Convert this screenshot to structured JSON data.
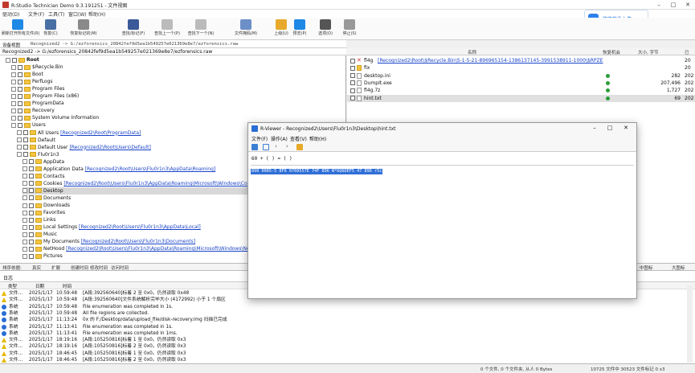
{
  "app": {
    "title": "R-Studio Technician Demo 9.3.191251 - 文件视图",
    "cloud_button": "拖拽至此上传"
  },
  "menu": [
    "驱动(D)",
    "文件(F)",
    "工具(T)",
    "窗口(W)",
    "帮助(H)"
  ],
  "toolbar": [
    {
      "label": "刷新打开所有文件(R)",
      "icon": "refresh-icon",
      "color": "#1e88e5"
    },
    {
      "label": "恢复(C)",
      "icon": "recover-icon",
      "color": "#4a6fa5"
    },
    {
      "label": "恢复标记的(M)",
      "icon": "recover-marked-icon",
      "color": "#8a8a8a"
    },
    {
      "label": "查找/标记(F)",
      "icon": "find-icon",
      "color": "#3b5998"
    },
    {
      "label": "查找上一个(P)",
      "icon": "find-prev-icon",
      "color": "#bbbbbb"
    },
    {
      "label": "查找下一个(N)",
      "icon": "find-next-icon",
      "color": "#bbbbbb"
    },
    {
      "label": "文件掩码(M)",
      "icon": "file-mask-icon",
      "color": "#6d8fc7"
    },
    {
      "label": "上级(U)",
      "icon": "up-folder-icon",
      "color": "#e8a92a"
    },
    {
      "label": "预览(P)",
      "icon": "preview-icon",
      "color": "#1e88e5"
    },
    {
      "label": "选项(O)",
      "icon": "options-icon",
      "color": "#555555"
    },
    {
      "label": "停止(S)",
      "icon": "stop-icon",
      "color": "#999999"
    }
  ],
  "address": {
    "label": "设备视图",
    "path": "Recognized2 -> G:/ezforensics_20842fef9d5ea1b549257e021369e8e7/ezforensics.raw"
  },
  "tree": {
    "root_item": "Recognized2 -> G:/ezforensics_20842fef9d5ea1b549257e021369e8e7/ezforensics.raw",
    "rows": [
      {
        "indent": 1,
        "label": "Root",
        "bold": true
      },
      {
        "indent": 2,
        "label": "$Recycle.Bin"
      },
      {
        "indent": 2,
        "label": "Boot"
      },
      {
        "indent": 2,
        "label": "PerfLogs"
      },
      {
        "indent": 2,
        "label": "Program Files"
      },
      {
        "indent": 2,
        "label": "Program Files (x86)"
      },
      {
        "indent": 2,
        "label": "ProgramData"
      },
      {
        "indent": 2,
        "label": "Recovery"
      },
      {
        "indent": 2,
        "label": "System Volume Information"
      },
      {
        "indent": 2,
        "label": "Users"
      },
      {
        "indent": 3,
        "label": "All Users",
        "link": "[Recognized2\\Root\\ProgramData]"
      },
      {
        "indent": 3,
        "label": "Default"
      },
      {
        "indent": 3,
        "label": "Default User",
        "link": "[Recognized2\\Root\\Users\\Default]"
      },
      {
        "indent": 3,
        "label": "Flu0r1n3"
      },
      {
        "indent": 4,
        "label": "AppData"
      },
      {
        "indent": 4,
        "label": "Application Data",
        "link": "[Recognized2\\Root\\Users\\Flu0r1n3\\AppData\\Roaming]"
      },
      {
        "indent": 4,
        "label": "Contacts"
      },
      {
        "indent": 4,
        "label": "Cookies",
        "link": "[Recognized2\\Root\\Users\\Flu0r1n3\\AppData\\Roaming\\Microsoft\\Windows\\Coo"
      },
      {
        "indent": 4,
        "label": "Desktop",
        "selected": true
      },
      {
        "indent": 4,
        "label": "Documents"
      },
      {
        "indent": 4,
        "label": "Downloads"
      },
      {
        "indent": 4,
        "label": "Favorites"
      },
      {
        "indent": 4,
        "label": "Links"
      },
      {
        "indent": 4,
        "label": "Local Settings",
        "link": "[Recognized2\\Root\\Users\\Flu0r1n3\\AppData\\Local]"
      },
      {
        "indent": 4,
        "label": "Music"
      },
      {
        "indent": 4,
        "label": "My Documents",
        "link": "[Recognized2\\Root\\Users\\Flu0r1n3\\Documents]"
      },
      {
        "indent": 4,
        "label": "NetHood",
        "link": "[Recognized2\\Root\\Users\\Flu0r1n3\\AppData\\Roaming\\Microsoft\\Windows\\Ne"
      },
      {
        "indent": 4,
        "label": "Pictures"
      }
    ]
  },
  "filelist": {
    "headers": [
      "名称",
      "恢复机会",
      "大小, 字节",
      "已"
    ],
    "rows": [
      {
        "name": "fl4g",
        "link": "[Recognized2\\Root\\$Recycle.Bin\\S-1-5-21-896965154-1386137145-3991538911-1000\\$RPZE",
        "icon": "deleted",
        "chance": false,
        "size": "",
        "extra": "20"
      },
      {
        "name": "fix",
        "link": "",
        "icon": "folder",
        "chance": false,
        "size": "",
        "extra": "20"
      },
      {
        "name": "desktop.ini",
        "link": "",
        "icon": "file",
        "chance": true,
        "size": "282",
        "extra": "202"
      },
      {
        "name": "DumpIt.exe",
        "link": "",
        "icon": "file",
        "chance": true,
        "size": "207,496",
        "extra": "202"
      },
      {
        "name": "fl4g.7z",
        "link": "",
        "icon": "file",
        "chance": true,
        "size": "1,727",
        "extra": "202"
      },
      {
        "name": "hint.txt",
        "link": "",
        "icon": "file",
        "chance": true,
        "size": "69",
        "extra": "202",
        "selected": true
      }
    ]
  },
  "sortbar": [
    "排序依据:",
    "真实",
    "扩展",
    "创建时间",
    "修改时间",
    "访问时间"
  ],
  "sortbar_right": [
    "中图标",
    "大图标"
  ],
  "log": {
    "title": "日志",
    "columns": [
      "类型",
      "日期",
      "时间"
    ],
    "rows": [
      {
        "type": "文件...",
        "kind": "warn",
        "date": "2025/1/17",
        "time": "10:59:48",
        "msg": "[A段:392560640]标着 2 至 0x0。仍然读取 0x48"
      },
      {
        "type": "文件...",
        "kind": "warn",
        "date": "2025/1/17",
        "time": "10:59:48",
        "msg": "[A段:392560640]文件系统解析完毕大小 (4172992) 小于 1 个扇区"
      },
      {
        "type": "系统",
        "kind": "info",
        "date": "2025/1/17",
        "time": "10:59:48",
        "msg": "File enumeration was completed in 1s."
      },
      {
        "type": "系统",
        "kind": "info",
        "date": "2025/1/17",
        "time": "10:59:48",
        "msg": "All file regions are collected."
      },
      {
        "type": "系统",
        "kind": "info",
        "date": "2025/1/17",
        "time": "11:13:24",
        "msg": "0x 的 F:/Desktop/data/upload_file/disk-recovery.img 扫描已完成"
      },
      {
        "type": "系统",
        "kind": "info",
        "date": "2025/1/17",
        "time": "11:13:41",
        "msg": "File enumeration was completed in 1s."
      },
      {
        "type": "系统",
        "kind": "info",
        "date": "2025/1/17",
        "time": "11:13:41",
        "msg": "File enumeration was completed in 1ms."
      },
      {
        "type": "文件...",
        "kind": "warn",
        "date": "2025/1/17",
        "time": "18:19:16",
        "msg": "[A段:105250816]标着 1 至 0x0。仍然读取 0x3"
      },
      {
        "type": "文件...",
        "kind": "warn",
        "date": "2025/1/17",
        "time": "18:19:16",
        "msg": "[A段:105250816]标着 2 至 0x0。仍然读取 0x3"
      },
      {
        "type": "文件...",
        "kind": "warn",
        "date": "2025/1/17",
        "time": "18:46:45",
        "msg": "[A段:105250816]标着 1 至 0x0。仍然读取 0x3"
      },
      {
        "type": "文件...",
        "kind": "warn",
        "date": "2025/1/17",
        "time": "18:46:45",
        "msg": "[A段:105250816]标着 2 至 0x0。仍然读取 0x3"
      }
    ]
  },
  "status": {
    "left": "0 个文件, 0 个文件夹, 从人 0 Bytes",
    "right": "10725 文件中 30523 文件标记 0 x3"
  },
  "viewer": {
    "title": "R-Viewer - Recognized2\\Users\\Flu0r1n3\\Desktop\\hint.txt",
    "menu": [
      "文件(F)",
      "操作(A)",
      "查看(V)",
      "帮助(H)"
    ],
    "header_line": "60 + ( ) = ( )",
    "highlight": "890 0085-5 8F6 0760557E 74F 896 N*6Q6DEF5 47 896 r5c"
  }
}
